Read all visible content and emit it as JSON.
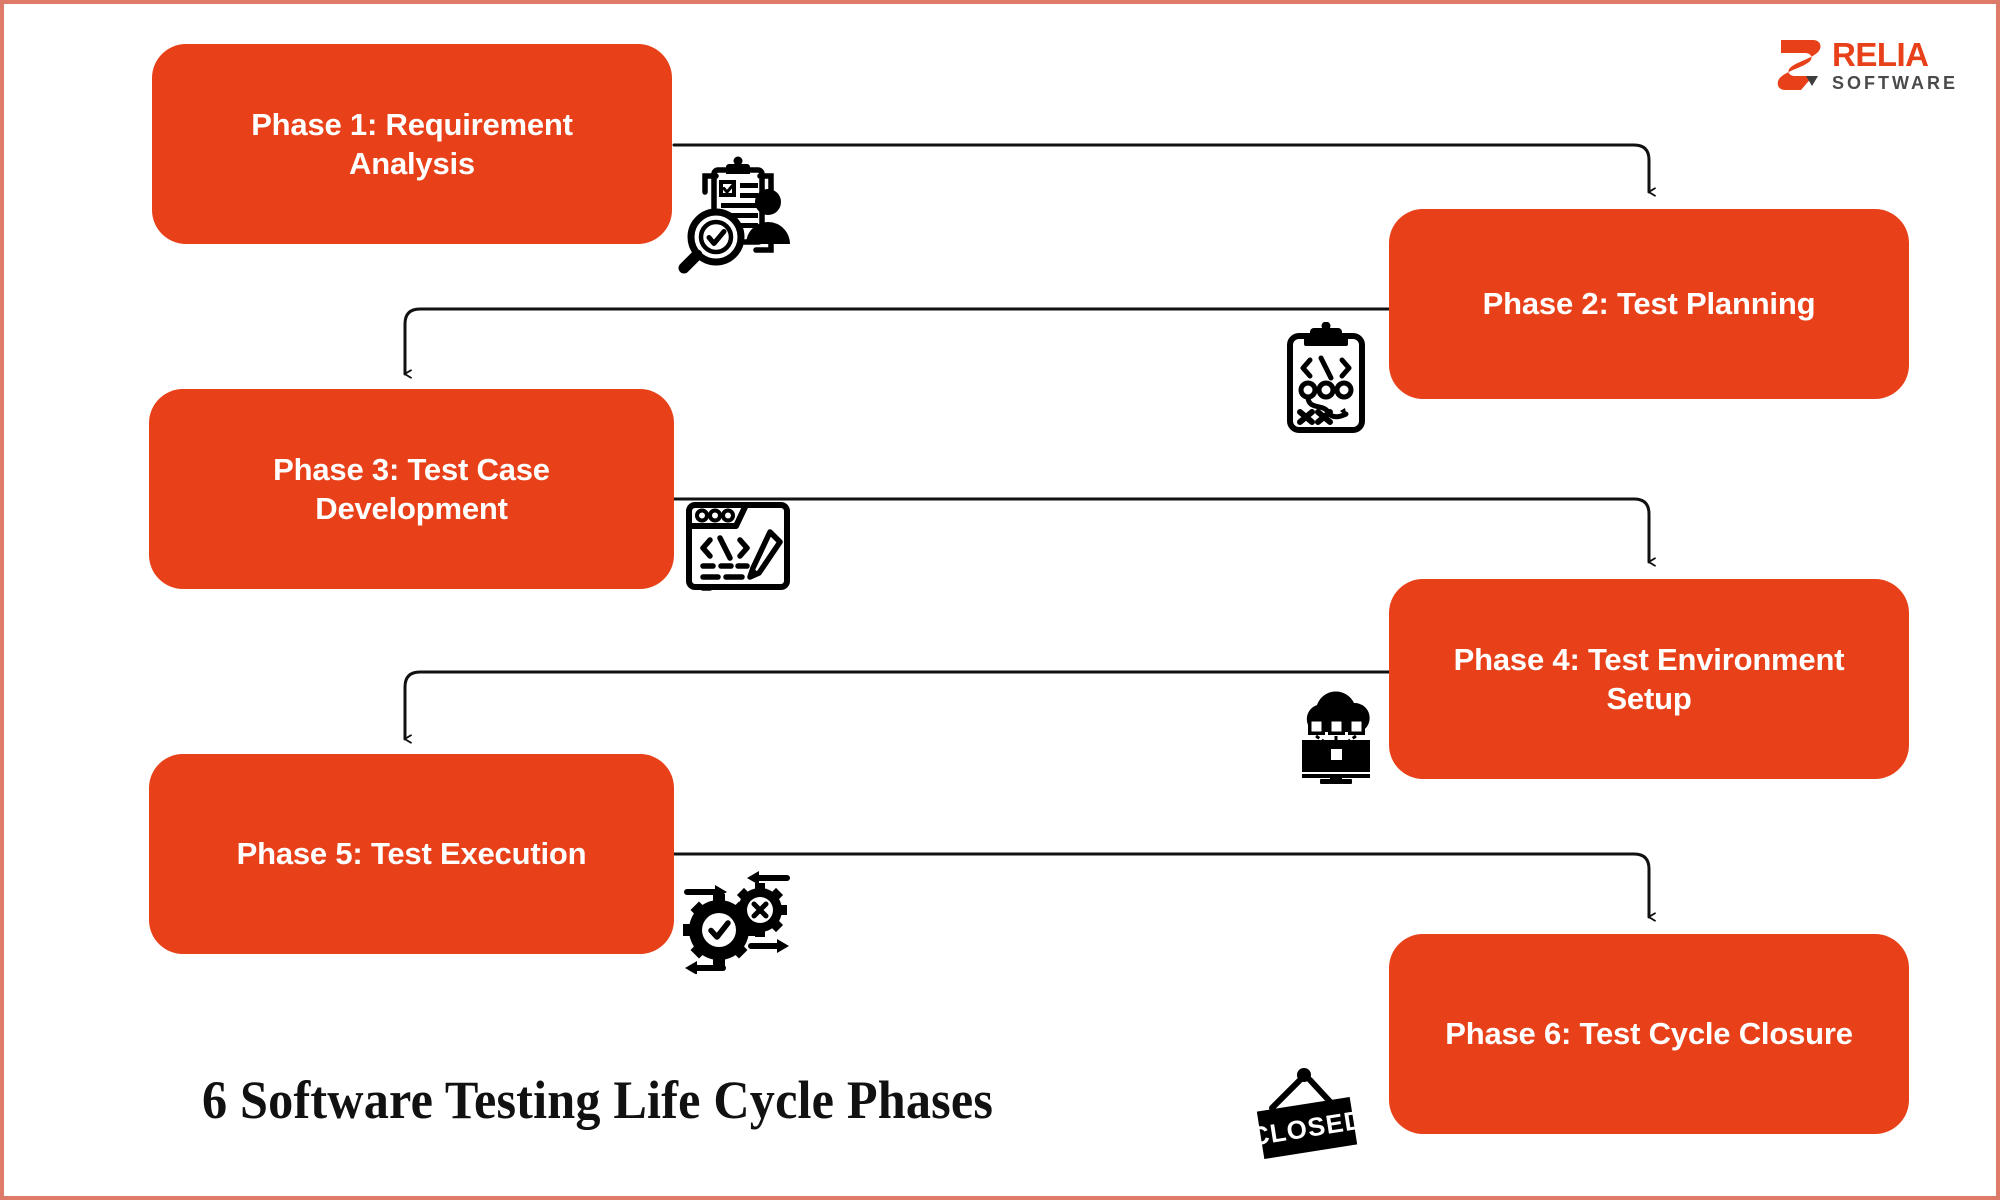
{
  "title": "6 Software Testing Life Cycle Phases",
  "brand": {
    "name": "RELIA",
    "subtitle": "SOFTWARE",
    "mark_icon": "relia-s-mark-icon",
    "accent_color": "#E8411A",
    "subtitle_color": "#4A4A4A"
  },
  "theme": {
    "box_fill": "#E8411A",
    "box_text": "#FFFFFF",
    "connector_stroke": "#111111",
    "page_border": "#DE7A68",
    "background": "#FFFFFF",
    "title_color": "#111111"
  },
  "phases": [
    {
      "id": 1,
      "label": "Phase 1: Requirement\nAnalysis",
      "icon": "clipboard-person-magnifier-icon"
    },
    {
      "id": 2,
      "label": "Phase 2: Test Planning",
      "icon": "clipboard-strategy-playbook-icon"
    },
    {
      "id": 3,
      "label": "Phase 3: Test Case\nDevelopment",
      "icon": "code-window-pencil-icon"
    },
    {
      "id": 4,
      "label": "Phase 4: Test Environment\nSetup",
      "icon": "cloud-network-monitor-icon"
    },
    {
      "id": 5,
      "label": "Phase 5: Test Execution",
      "icon": "gears-check-cross-arrows-icon"
    },
    {
      "id": 6,
      "label": "Phase 6: Test Cycle Closure",
      "icon": "closed-hanging-sign-icon"
    }
  ],
  "connectors": [
    {
      "from": 1,
      "to": 2,
      "direction": "right-then-down"
    },
    {
      "from": 2,
      "to": 3,
      "direction": "left-then-down"
    },
    {
      "from": 3,
      "to": 4,
      "direction": "right-then-down"
    },
    {
      "from": 4,
      "to": 5,
      "direction": "left-then-down"
    },
    {
      "from": 5,
      "to": 6,
      "direction": "right-then-down"
    }
  ],
  "icon_labels": {
    "closed_sign_text": "CLOSED"
  }
}
